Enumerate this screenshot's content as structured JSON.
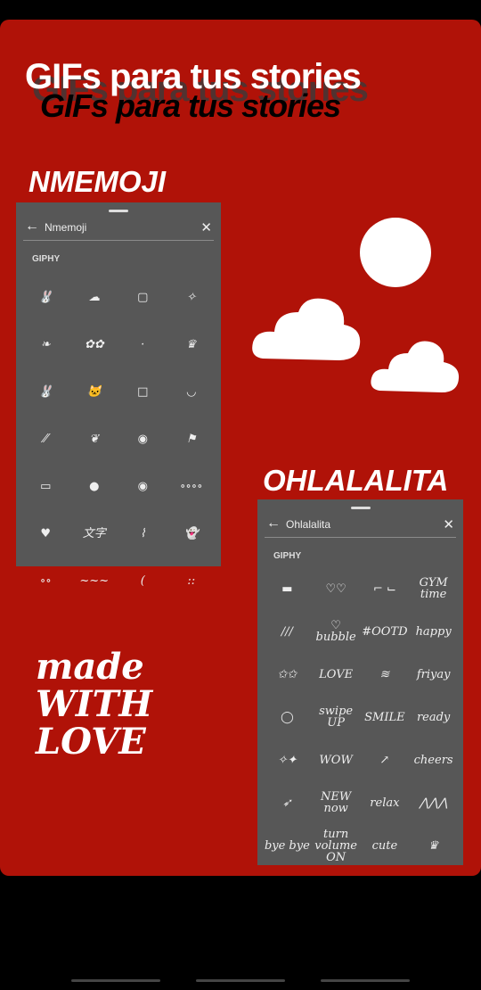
{
  "title": "GIFs para tus stories",
  "sections": [
    {
      "label": "NMEMOJI",
      "search_query": "Nmemoji",
      "provider": "GIPHY",
      "stickers": [
        "🐰",
        "☁",
        "▢",
        "✧",
        "❧",
        "✿✿",
        "·",
        "♛",
        "🐰",
        "🐱",
        "□",
        "◡",
        "⁄⁄",
        "❦",
        "◉",
        "⚑",
        "▭",
        "●",
        "◉",
        "∘∘∘∘",
        "♥",
        "文字",
        "⌇",
        "👻",
        "∘∘",
        "~~~",
        "(",
        "::"
      ]
    },
    {
      "label": "OHLALALITA",
      "search_query": "Ohlalalita",
      "provider": "GIPHY",
      "stickers": [
        "▬",
        "♡♡",
        "⌐ ⌙",
        "GYM time",
        "///",
        "♡ bubble",
        "#OOTD",
        "happy",
        "✩✩",
        "LOVE",
        "≋",
        "friyay",
        "◯",
        "swipe UP",
        "SMILE",
        "ready",
        "✧✦",
        "WOW",
        "↗",
        "cheers",
        "➶",
        "NEW now",
        "relax",
        "⋀⋀⋀",
        "bye bye",
        "turn volume ON",
        "cute",
        "♛"
      ]
    }
  ],
  "decoration": {
    "made_with_love": "made WITH LOVE"
  },
  "colors": {
    "background": "#b01208",
    "panel": "#575757"
  }
}
